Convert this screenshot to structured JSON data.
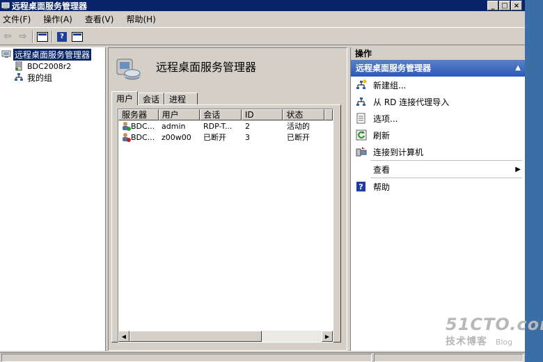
{
  "window": {
    "title": "远程桌面服务管理器"
  },
  "menu": [
    "文件(F)",
    "操作(A)",
    "查看(V)",
    "帮助(H)"
  ],
  "tree": {
    "root": "远程桌面服务管理器",
    "children": [
      "BDC2008r2",
      "我的组"
    ]
  },
  "main": {
    "heading": "远程桌面服务管理器",
    "tabs": [
      "用户",
      "会话",
      "进程"
    ],
    "columns": [
      "服务器",
      "用户",
      "会话",
      "ID",
      "状态"
    ],
    "rows": [
      [
        "BDC...",
        "admin",
        "RDP-T...",
        "2",
        "活动的"
      ],
      [
        "BDC...",
        "z00w00",
        "已断开",
        "3",
        "已断开"
      ]
    ]
  },
  "actions": {
    "title": "操作",
    "group": "远程桌面服务管理器",
    "items": [
      "新建组...",
      "从 RD 连接代理导入",
      "选项...",
      "刷新",
      "连接到计算机",
      "查看",
      "帮助"
    ]
  },
  "watermark": {
    "line1": "51CTO.com",
    "line2": "技术博客",
    "line3": "Blog"
  },
  "icons": {
    "app": "remote-desktop-icon",
    "server": "server-icon",
    "group": "group-icon",
    "user_active": "user-active-icon",
    "user_disconnected": "user-disconnected-icon"
  }
}
